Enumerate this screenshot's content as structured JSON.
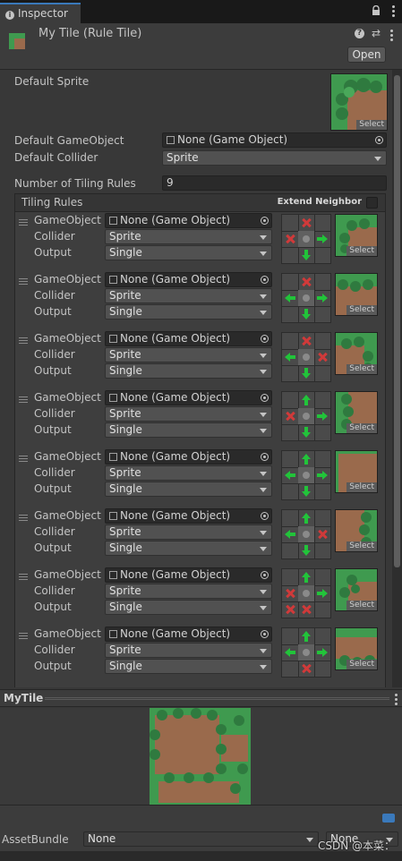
{
  "tab": {
    "label": "Inspector"
  },
  "header": {
    "title": "My Tile (Rule Tile)",
    "open_label": "Open",
    "preset_glyph": "⇄"
  },
  "fields": {
    "default_sprite_label": "Default Sprite",
    "select_label": "Select",
    "default_gameobject_label": "Default GameObject",
    "default_gameobject_value": "None (Game Object)",
    "default_collider_label": "Default Collider",
    "default_collider_value": "Sprite",
    "num_rules_label": "Number of Tiling Rules",
    "num_rules_value": "9"
  },
  "tiling_rules": {
    "title": "Tiling Rules",
    "extend_neighbor_label": "Extend Neighbor",
    "row_labels": {
      "gameobject": "GameObject",
      "collider": "Collider",
      "output": "Output"
    },
    "rules": [
      {
        "gameobject": "None (Game Object)",
        "collider": "Sprite",
        "output": "Single",
        "cells": [
          "",
          "x",
          "",
          "x",
          "",
          "right",
          "",
          "down",
          ""
        ],
        "preview": "corner-tl"
      },
      {
        "gameobject": "None (Game Object)",
        "collider": "Sprite",
        "output": "Single",
        "cells": [
          "",
          "x",
          "",
          "left",
          "",
          "right",
          "",
          "down",
          ""
        ],
        "preview": "top"
      },
      {
        "gameobject": "None (Game Object)",
        "collider": "Sprite",
        "output": "Single",
        "cells": [
          "",
          "x",
          "",
          "left",
          "",
          "x",
          "",
          "down",
          ""
        ],
        "preview": "corner-tr"
      },
      {
        "gameobject": "None (Game Object)",
        "collider": "Sprite",
        "output": "Single",
        "cells": [
          "",
          "up",
          "",
          "x",
          "",
          "right",
          "",
          "down",
          ""
        ],
        "preview": "left"
      },
      {
        "gameobject": "None (Game Object)",
        "collider": "Sprite",
        "output": "Single",
        "cells": [
          "",
          "up",
          "",
          "left",
          "",
          "right",
          "",
          "down",
          ""
        ],
        "preview": "center"
      },
      {
        "gameobject": "None (Game Object)",
        "collider": "Sprite",
        "output": "Single",
        "cells": [
          "",
          "up",
          "",
          "left",
          "",
          "x",
          "",
          "down",
          ""
        ],
        "preview": "right"
      },
      {
        "gameobject": "None (Game Object)",
        "collider": "Sprite",
        "output": "Single",
        "cells": [
          "",
          "up",
          "",
          "x",
          "",
          "right",
          "x",
          "x",
          ""
        ],
        "preview": "corner-bl"
      },
      {
        "gameobject": "None (Game Object)",
        "collider": "Sprite",
        "output": "Single",
        "cells": [
          "",
          "up",
          "",
          "left",
          "",
          "right",
          "",
          "x",
          ""
        ],
        "preview": "bottom"
      }
    ]
  },
  "preview_section": {
    "title": "MyTile"
  },
  "asset_bundle": {
    "label": "AssetBundle",
    "value": "None",
    "variant": "None"
  },
  "watermark": "CSDN @本菜：",
  "colors": {
    "accent": "#3a79bb",
    "arrow_green": "#22c33a",
    "x_red": "#d03a3a",
    "grass": "#3f9a4f",
    "dirt": "#9a6a4c"
  }
}
